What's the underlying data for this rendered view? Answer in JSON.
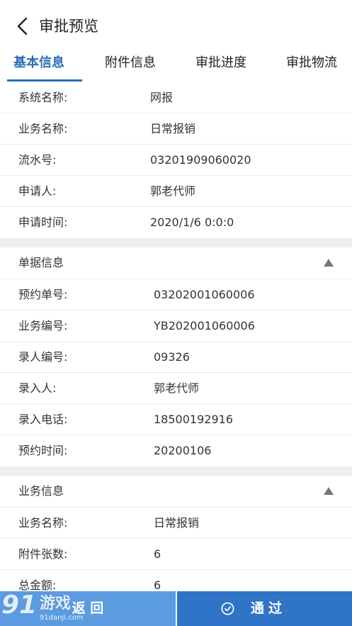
{
  "header": {
    "title": "审批预览"
  },
  "tabs": [
    {
      "label": "基本信息",
      "active": true
    },
    {
      "label": "附件信息",
      "active": false
    },
    {
      "label": "审批进度",
      "active": false
    },
    {
      "label": "审批物流",
      "active": false
    }
  ],
  "basic_info": [
    {
      "label": "系统名称:",
      "value": "网报"
    },
    {
      "label": "业务名称:",
      "value": "日常报销"
    },
    {
      "label": "流水号:",
      "value": "03201909060020"
    },
    {
      "label": "申请人:",
      "value": "郭老代师"
    },
    {
      "label": "申请时间:",
      "value": "2020/1/6 0:0:0"
    }
  ],
  "document_section": {
    "title": "单据信息",
    "rows": [
      {
        "label": "预约单号:",
        "value": "03202001060006"
      },
      {
        "label": "业务编号:",
        "value": "YB202001060006"
      },
      {
        "label": "录人编号:",
        "value": "09326"
      },
      {
        "label": "录入人:",
        "value": "郭老代师"
      },
      {
        "label": "录入电话:",
        "value": "18500192916"
      },
      {
        "label": "预约时间:",
        "value": "20200106"
      }
    ]
  },
  "business_section": {
    "title": "业务信息",
    "rows": [
      {
        "label": "业务名称:",
        "value": "日常报销"
      },
      {
        "label": "附件张数:",
        "value": "6"
      },
      {
        "label": "总金额:",
        "value": "6"
      }
    ]
  },
  "footer": {
    "back_label": "返 回",
    "pass_label": "通过"
  },
  "watermark": {
    "logo": "91",
    "name": "游戏",
    "url": "91danji.com"
  },
  "colors": {
    "accent": "#2d6fb8",
    "back_button": "#5b9be0",
    "pass_button": "#2f74c6",
    "section_gap": "#efefef"
  }
}
